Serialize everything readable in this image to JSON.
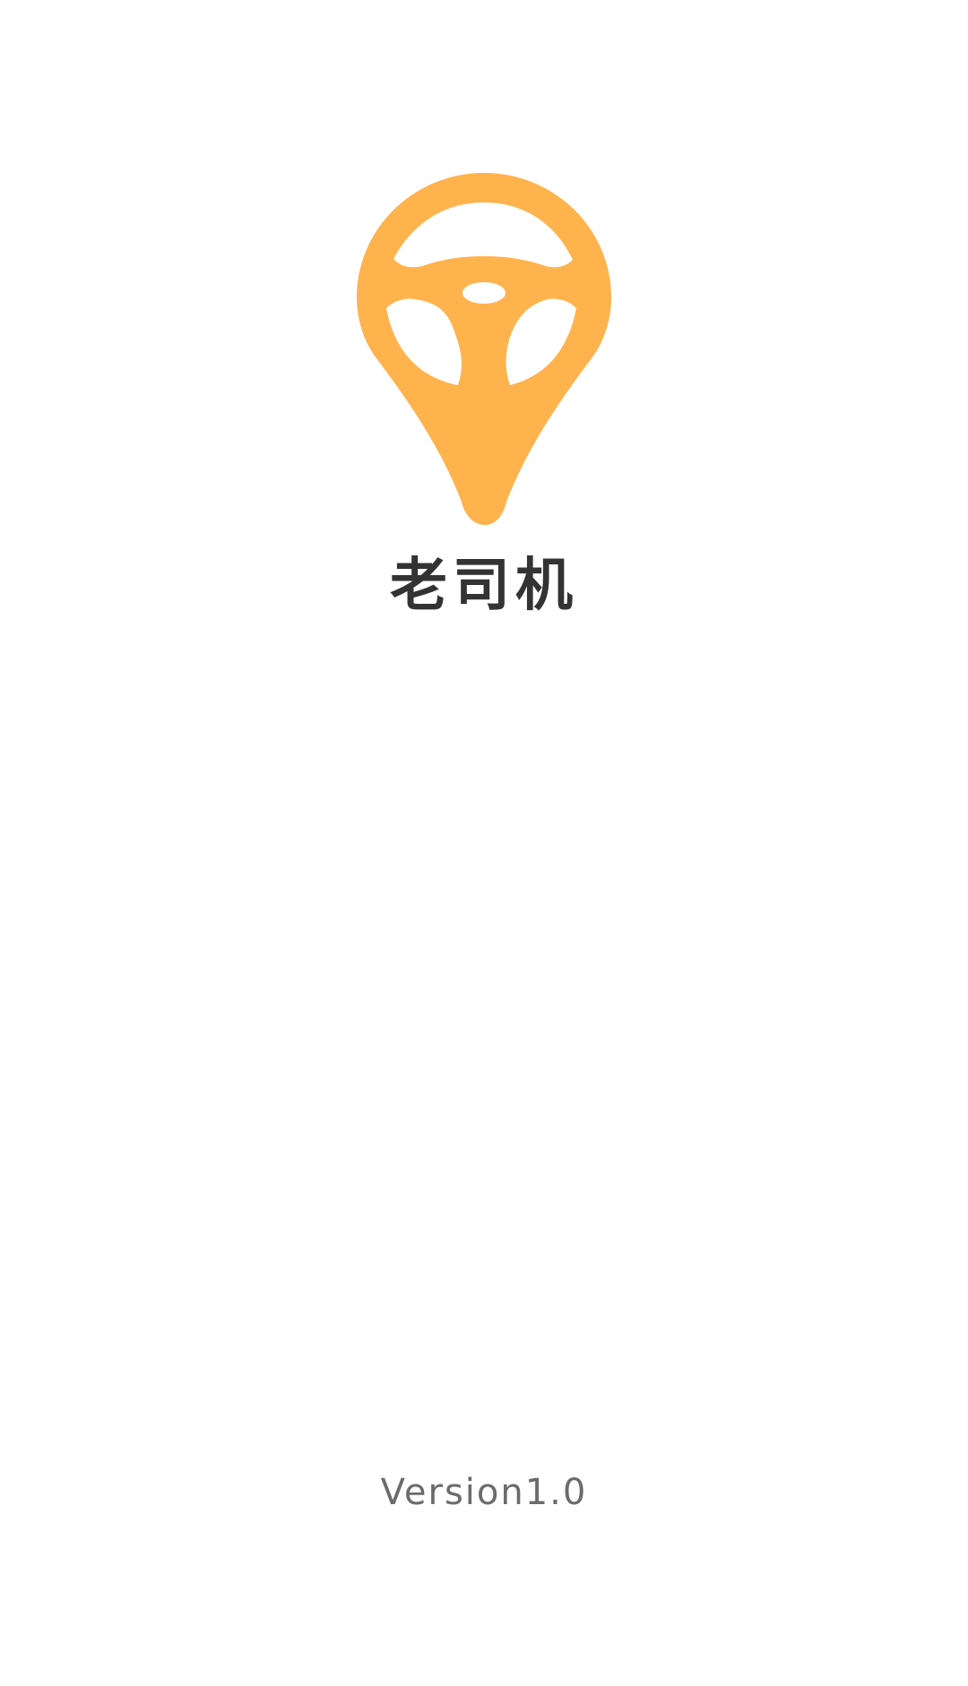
{
  "app": {
    "name": "老司机",
    "version": "Version1.0",
    "logo_icon": "steering-wheel-location-pin-icon",
    "brand_color": "#FFB34D",
    "text_color": "#333333",
    "version_color": "#6B6B6B"
  }
}
